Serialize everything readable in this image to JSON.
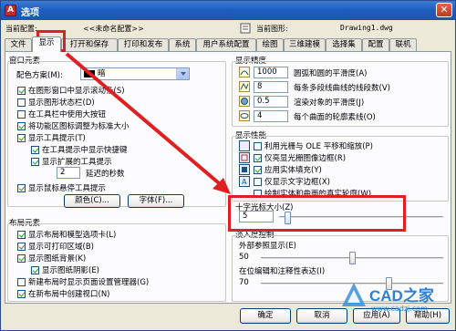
{
  "window": {
    "title": "选项"
  },
  "header": {
    "profile_label": "当前配置:",
    "profile_value": "<<未命名配置>>",
    "drawing_label": "当前图形:",
    "drawing_value": "Drawing1.dwg"
  },
  "tabs": [
    {
      "label": "文件"
    },
    {
      "label": "显示",
      "active": true
    },
    {
      "label": "打开和保存"
    },
    {
      "label": "打印和发布"
    },
    {
      "label": "系统"
    },
    {
      "label": "用户系统配置"
    },
    {
      "label": "绘图"
    },
    {
      "label": "三维建模"
    },
    {
      "label": "选择集"
    },
    {
      "label": "配置"
    },
    {
      "label": "联机"
    }
  ],
  "window_elements": {
    "title": "窗口元素",
    "color_scheme_label": "配色方案(M):",
    "color_scheme_value": "暗",
    "checkboxes": [
      {
        "label": "在图形窗口中显示滚动条(S)",
        "checked": true
      },
      {
        "label": "显示图形状态栏(D)",
        "checked": false
      },
      {
        "label": "在工具栏中使用大按钮",
        "checked": false
      },
      {
        "label": "将功能区图标调整为标准大小",
        "checked": true
      },
      {
        "label": "显示工具提示(T)",
        "checked": true
      },
      {
        "label": "在工具提示中显示快捷键",
        "checked": true
      },
      {
        "label": "显示扩展的工具提示",
        "checked": true
      }
    ],
    "delay_value": "2",
    "delay_label": "延迟的秒数",
    "rollover_label": "显示鼠标悬停工具提示",
    "rollover_checked": true,
    "colors_button": "颜色(C)...",
    "fonts_button": "字体(F)..."
  },
  "layout_elements": {
    "title": "布局元素",
    "checkboxes": [
      {
        "label": "显示布局和模型选项卡(L)",
        "checked": true
      },
      {
        "label": "显示可打印区域(B)",
        "checked": true
      },
      {
        "label": "显示图纸背景(K)",
        "checked": true
      },
      {
        "label": "显示图纸阴影(E)",
        "checked": true
      },
      {
        "label": "新建布局时显示页面设置管理器(G)",
        "checked": false
      },
      {
        "label": "在新布局中创建视口(N)",
        "checked": true
      }
    ]
  },
  "display_resolution": {
    "title": "显示精度",
    "rows": [
      {
        "value": "1000",
        "label": "圆弧和圆的平滑度(A)"
      },
      {
        "value": "8",
        "label": "每条多段线曲线的线段数(V)"
      },
      {
        "value": "0.5",
        "label": "渲染对象的平滑度(J)"
      },
      {
        "value": "4",
        "label": "每个曲面的轮廓素线(O)"
      }
    ]
  },
  "display_performance": {
    "title": "显示性能",
    "checkboxes": [
      {
        "label": "利用光栅与 OLE 平移和缩放(P)",
        "checked": false
      },
      {
        "label": "仅亮显光栅图像边框(R)",
        "checked": true
      },
      {
        "label": "应用实体填充(Y)",
        "checked": true
      },
      {
        "label": "仅显示文字边框(X)",
        "checked": false
      },
      {
        "label": "绘制实体和曲面的真实轮廓(W)",
        "checked": false
      }
    ]
  },
  "crosshair": {
    "title": "十字光标大小(Z)",
    "value": "5",
    "slider_fraction": 0.05
  },
  "fade_control": {
    "title": "淡入度控制",
    "xref_label": "外部参照显示(E)",
    "xref_value": "50",
    "xref_fraction": 0.5,
    "inplace_label": "在位编辑和注释性表达(I)",
    "inplace_value": "70",
    "inplace_fraction": 0.7
  },
  "footer": {
    "ok": "确定",
    "cancel": "取消",
    "apply": "应用(A)",
    "help": "帮助(H)"
  },
  "watermark": {
    "text": "CAD之家",
    "url": "www.cadzj.com"
  },
  "colors": {
    "highlight": "#e02020",
    "title_bar": "#1f5fbf",
    "accent_check": "#21a121"
  }
}
